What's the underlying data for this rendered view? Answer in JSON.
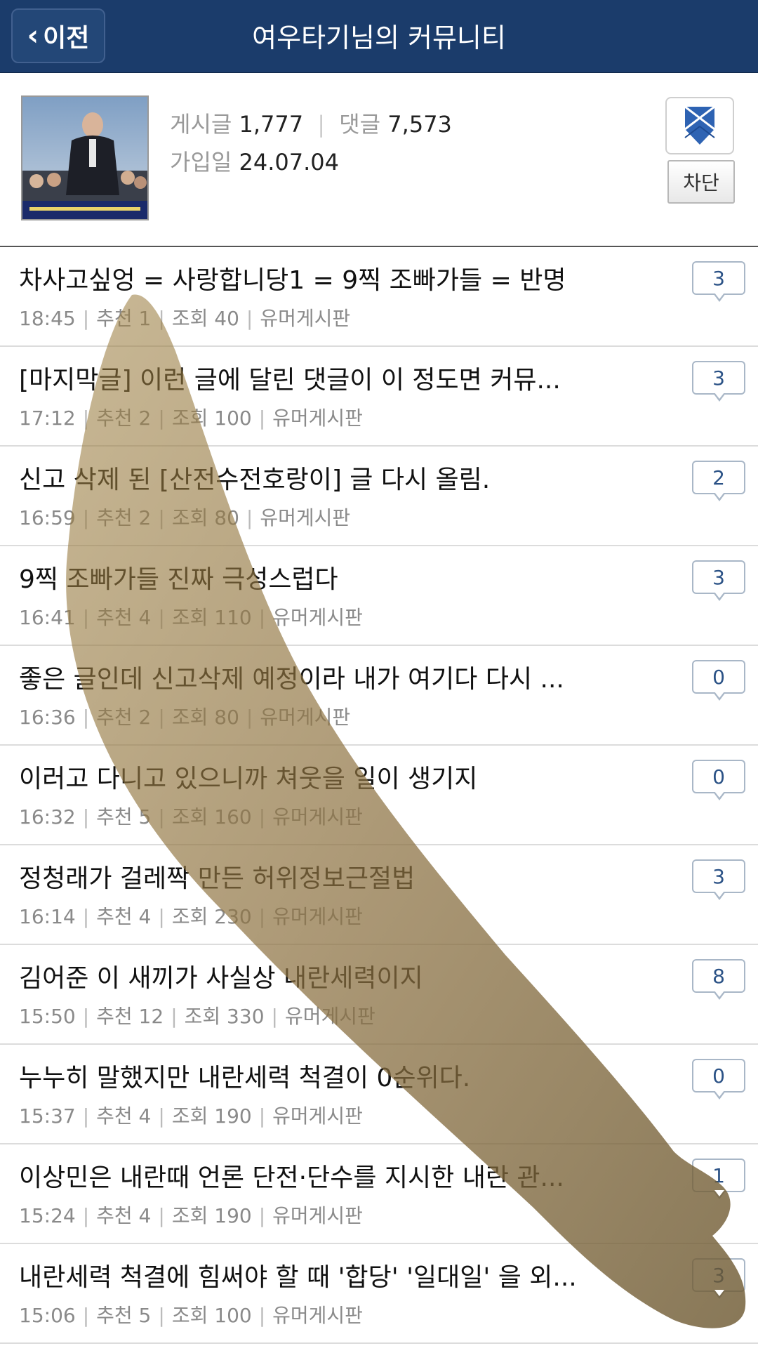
{
  "header": {
    "back_label": "이전",
    "title": "여우타기님의 커뮤니티",
    "color": "#1b3c6b"
  },
  "profile": {
    "posts_label": "게시글",
    "posts_count": "1,777",
    "comments_label": "댓글",
    "comments_count": "7,573",
    "joined_label": "가입일",
    "joined_date": "24.07.04",
    "block_label": "차단",
    "badge_icon": "blue-ribbon-badge-icon"
  },
  "posts": [
    {
      "title": "차사고싶엉 = 사랑합니당1 = 9찍 조빠가들 = 반명",
      "time": "18:45",
      "recommend": "추천 1",
      "views": "조회 40",
      "board": "유머게시판",
      "comments": "3"
    },
    {
      "title": "[마지막글] 이런 글에 달린 댓글이 이 정도면 커뮤...",
      "time": "17:12",
      "recommend": "추천 2",
      "views": "조회 100",
      "board": "유머게시판",
      "comments": "3"
    },
    {
      "title": "신고 삭제 된 [산전수전호랑이] 글 다시 올림.",
      "time": "16:59",
      "recommend": "추천 2",
      "views": "조회 80",
      "board": "유머게시판",
      "comments": "2"
    },
    {
      "title": "9찍 조빠가들 진짜 극성스럽다",
      "time": "16:41",
      "recommend": "추천 4",
      "views": "조회 110",
      "board": "유머게시판",
      "comments": "3"
    },
    {
      "title": "좋은 글인데 신고삭제 예정이라 내가 여기다 다시 ...",
      "time": "16:36",
      "recommend": "추천 2",
      "views": "조회 80",
      "board": "유머게시판",
      "comments": "0"
    },
    {
      "title": "이러고 다니고 있으니까 쳐웃을 일이 생기지",
      "time": "16:32",
      "recommend": "추천 5",
      "views": "조회 160",
      "board": "유머게시판",
      "comments": "0"
    },
    {
      "title": "정청래가 걸레짝 만든 허위정보근절법",
      "time": "16:14",
      "recommend": "추천 4",
      "views": "조회 230",
      "board": "유머게시판",
      "comments": "3"
    },
    {
      "title": "김어준 이 새끼가 사실상 내란세력이지",
      "time": "15:50",
      "recommend": "추천 12",
      "views": "조회 330",
      "board": "유머게시판",
      "comments": "8"
    },
    {
      "title": "누누히 말했지만 내란세력 척결이 0순위다.",
      "time": "15:37",
      "recommend": "추천 4",
      "views": "조회 190",
      "board": "유머게시판",
      "comments": "0"
    },
    {
      "title": "이상민은 내란때 언론 단전·단수를 지시한 내란 관...",
      "time": "15:24",
      "recommend": "추천 4",
      "views": "조회 190",
      "board": "유머게시판",
      "comments": "1"
    },
    {
      "title": "내란세력 척결에 힘써야 할 때 '합당' '일대일' 을 외...",
      "time": "15:06",
      "recommend": "추천 5",
      "views": "조회 100",
      "board": "유머게시판",
      "comments": "3"
    }
  ]
}
